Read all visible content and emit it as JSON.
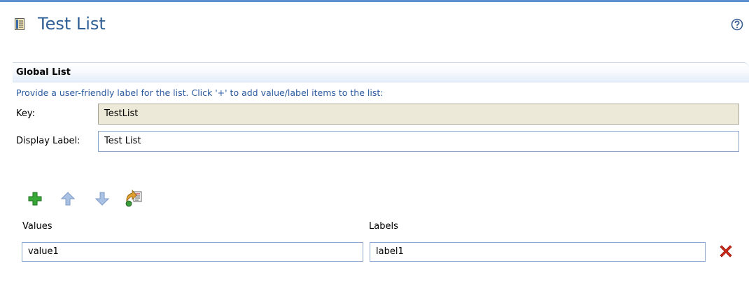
{
  "header": {
    "title": "Test List",
    "icon": "document-icon",
    "help_icon": "help-icon"
  },
  "section": {
    "title": "Global List",
    "description": "Provide a user-friendly label for the list.  Click '+' to add value/label items to the list:"
  },
  "fields": {
    "key": {
      "label": "Key:",
      "value": "TestList"
    },
    "display_label": {
      "label": "Display Label:",
      "value": "Test List"
    }
  },
  "toolbar": {
    "icons": [
      "add-icon",
      "move-up-icon",
      "move-down-icon",
      "import-icon"
    ],
    "colors": {
      "add": "#2e9e2e",
      "arrows": "#98b3d8",
      "delete": "#d22a1a"
    }
  },
  "table": {
    "columns": [
      "Values",
      "Labels"
    ],
    "rows": [
      {
        "value": "value1",
        "label": "label1"
      }
    ]
  },
  "colors": {
    "title": "#2f5f95",
    "accent_border": "#5b8fce",
    "description": "#2a5aa0",
    "readonly_bg": "#ece9d8"
  }
}
